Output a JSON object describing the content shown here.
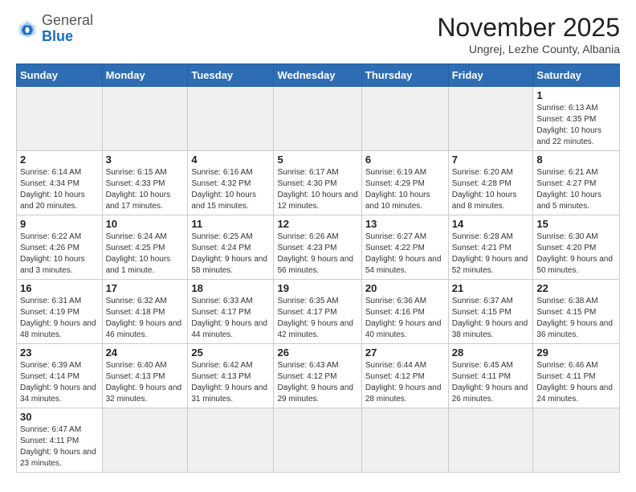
{
  "logo": {
    "general": "General",
    "blue": "Blue"
  },
  "header": {
    "month": "November 2025",
    "location": "Ungrej, Lezhe County, Albania"
  },
  "weekdays": [
    "Sunday",
    "Monday",
    "Tuesday",
    "Wednesday",
    "Thursday",
    "Friday",
    "Saturday"
  ],
  "weeks": [
    [
      {
        "day": "",
        "info": ""
      },
      {
        "day": "",
        "info": ""
      },
      {
        "day": "",
        "info": ""
      },
      {
        "day": "",
        "info": ""
      },
      {
        "day": "",
        "info": ""
      },
      {
        "day": "",
        "info": ""
      },
      {
        "day": "1",
        "info": "Sunrise: 6:13 AM\nSunset: 4:35 PM\nDaylight: 10 hours\nand 22 minutes."
      }
    ],
    [
      {
        "day": "2",
        "info": "Sunrise: 6:14 AM\nSunset: 4:34 PM\nDaylight: 10 hours\nand 20 minutes."
      },
      {
        "day": "3",
        "info": "Sunrise: 6:15 AM\nSunset: 4:33 PM\nDaylight: 10 hours\nand 17 minutes."
      },
      {
        "day": "4",
        "info": "Sunrise: 6:16 AM\nSunset: 4:32 PM\nDaylight: 10 hours\nand 15 minutes."
      },
      {
        "day": "5",
        "info": "Sunrise: 6:17 AM\nSunset: 4:30 PM\nDaylight: 10 hours\nand 12 minutes."
      },
      {
        "day": "6",
        "info": "Sunrise: 6:19 AM\nSunset: 4:29 PM\nDaylight: 10 hours\nand 10 minutes."
      },
      {
        "day": "7",
        "info": "Sunrise: 6:20 AM\nSunset: 4:28 PM\nDaylight: 10 hours\nand 8 minutes."
      },
      {
        "day": "8",
        "info": "Sunrise: 6:21 AM\nSunset: 4:27 PM\nDaylight: 10 hours\nand 5 minutes."
      }
    ],
    [
      {
        "day": "9",
        "info": "Sunrise: 6:22 AM\nSunset: 4:26 PM\nDaylight: 10 hours\nand 3 minutes."
      },
      {
        "day": "10",
        "info": "Sunrise: 6:24 AM\nSunset: 4:25 PM\nDaylight: 10 hours\nand 1 minute."
      },
      {
        "day": "11",
        "info": "Sunrise: 6:25 AM\nSunset: 4:24 PM\nDaylight: 9 hours\nand 58 minutes."
      },
      {
        "day": "12",
        "info": "Sunrise: 6:26 AM\nSunset: 4:23 PM\nDaylight: 9 hours\nand 56 minutes."
      },
      {
        "day": "13",
        "info": "Sunrise: 6:27 AM\nSunset: 4:22 PM\nDaylight: 9 hours\nand 54 minutes."
      },
      {
        "day": "14",
        "info": "Sunrise: 6:28 AM\nSunset: 4:21 PM\nDaylight: 9 hours\nand 52 minutes."
      },
      {
        "day": "15",
        "info": "Sunrise: 6:30 AM\nSunset: 4:20 PM\nDaylight: 9 hours\nand 50 minutes."
      }
    ],
    [
      {
        "day": "16",
        "info": "Sunrise: 6:31 AM\nSunset: 4:19 PM\nDaylight: 9 hours\nand 48 minutes."
      },
      {
        "day": "17",
        "info": "Sunrise: 6:32 AM\nSunset: 4:18 PM\nDaylight: 9 hours\nand 46 minutes."
      },
      {
        "day": "18",
        "info": "Sunrise: 6:33 AM\nSunset: 4:17 PM\nDaylight: 9 hours\nand 44 minutes."
      },
      {
        "day": "19",
        "info": "Sunrise: 6:35 AM\nSunset: 4:17 PM\nDaylight: 9 hours\nand 42 minutes."
      },
      {
        "day": "20",
        "info": "Sunrise: 6:36 AM\nSunset: 4:16 PM\nDaylight: 9 hours\nand 40 minutes."
      },
      {
        "day": "21",
        "info": "Sunrise: 6:37 AM\nSunset: 4:15 PM\nDaylight: 9 hours\nand 38 minutes."
      },
      {
        "day": "22",
        "info": "Sunrise: 6:38 AM\nSunset: 4:15 PM\nDaylight: 9 hours\nand 36 minutes."
      }
    ],
    [
      {
        "day": "23",
        "info": "Sunrise: 6:39 AM\nSunset: 4:14 PM\nDaylight: 9 hours\nand 34 minutes."
      },
      {
        "day": "24",
        "info": "Sunrise: 6:40 AM\nSunset: 4:13 PM\nDaylight: 9 hours\nand 32 minutes."
      },
      {
        "day": "25",
        "info": "Sunrise: 6:42 AM\nSunset: 4:13 PM\nDaylight: 9 hours\nand 31 minutes."
      },
      {
        "day": "26",
        "info": "Sunrise: 6:43 AM\nSunset: 4:12 PM\nDaylight: 9 hours\nand 29 minutes."
      },
      {
        "day": "27",
        "info": "Sunrise: 6:44 AM\nSunset: 4:12 PM\nDaylight: 9 hours\nand 28 minutes."
      },
      {
        "day": "28",
        "info": "Sunrise: 6:45 AM\nSunset: 4:11 PM\nDaylight: 9 hours\nand 26 minutes."
      },
      {
        "day": "29",
        "info": "Sunrise: 6:46 AM\nSunset: 4:11 PM\nDaylight: 9 hours\nand 24 minutes."
      }
    ],
    [
      {
        "day": "30",
        "info": "Sunrise: 6:47 AM\nSunset: 4:11 PM\nDaylight: 9 hours\nand 23 minutes."
      },
      {
        "day": "",
        "info": ""
      },
      {
        "day": "",
        "info": ""
      },
      {
        "day": "",
        "info": ""
      },
      {
        "day": "",
        "info": ""
      },
      {
        "day": "",
        "info": ""
      },
      {
        "day": "",
        "info": ""
      }
    ]
  ]
}
